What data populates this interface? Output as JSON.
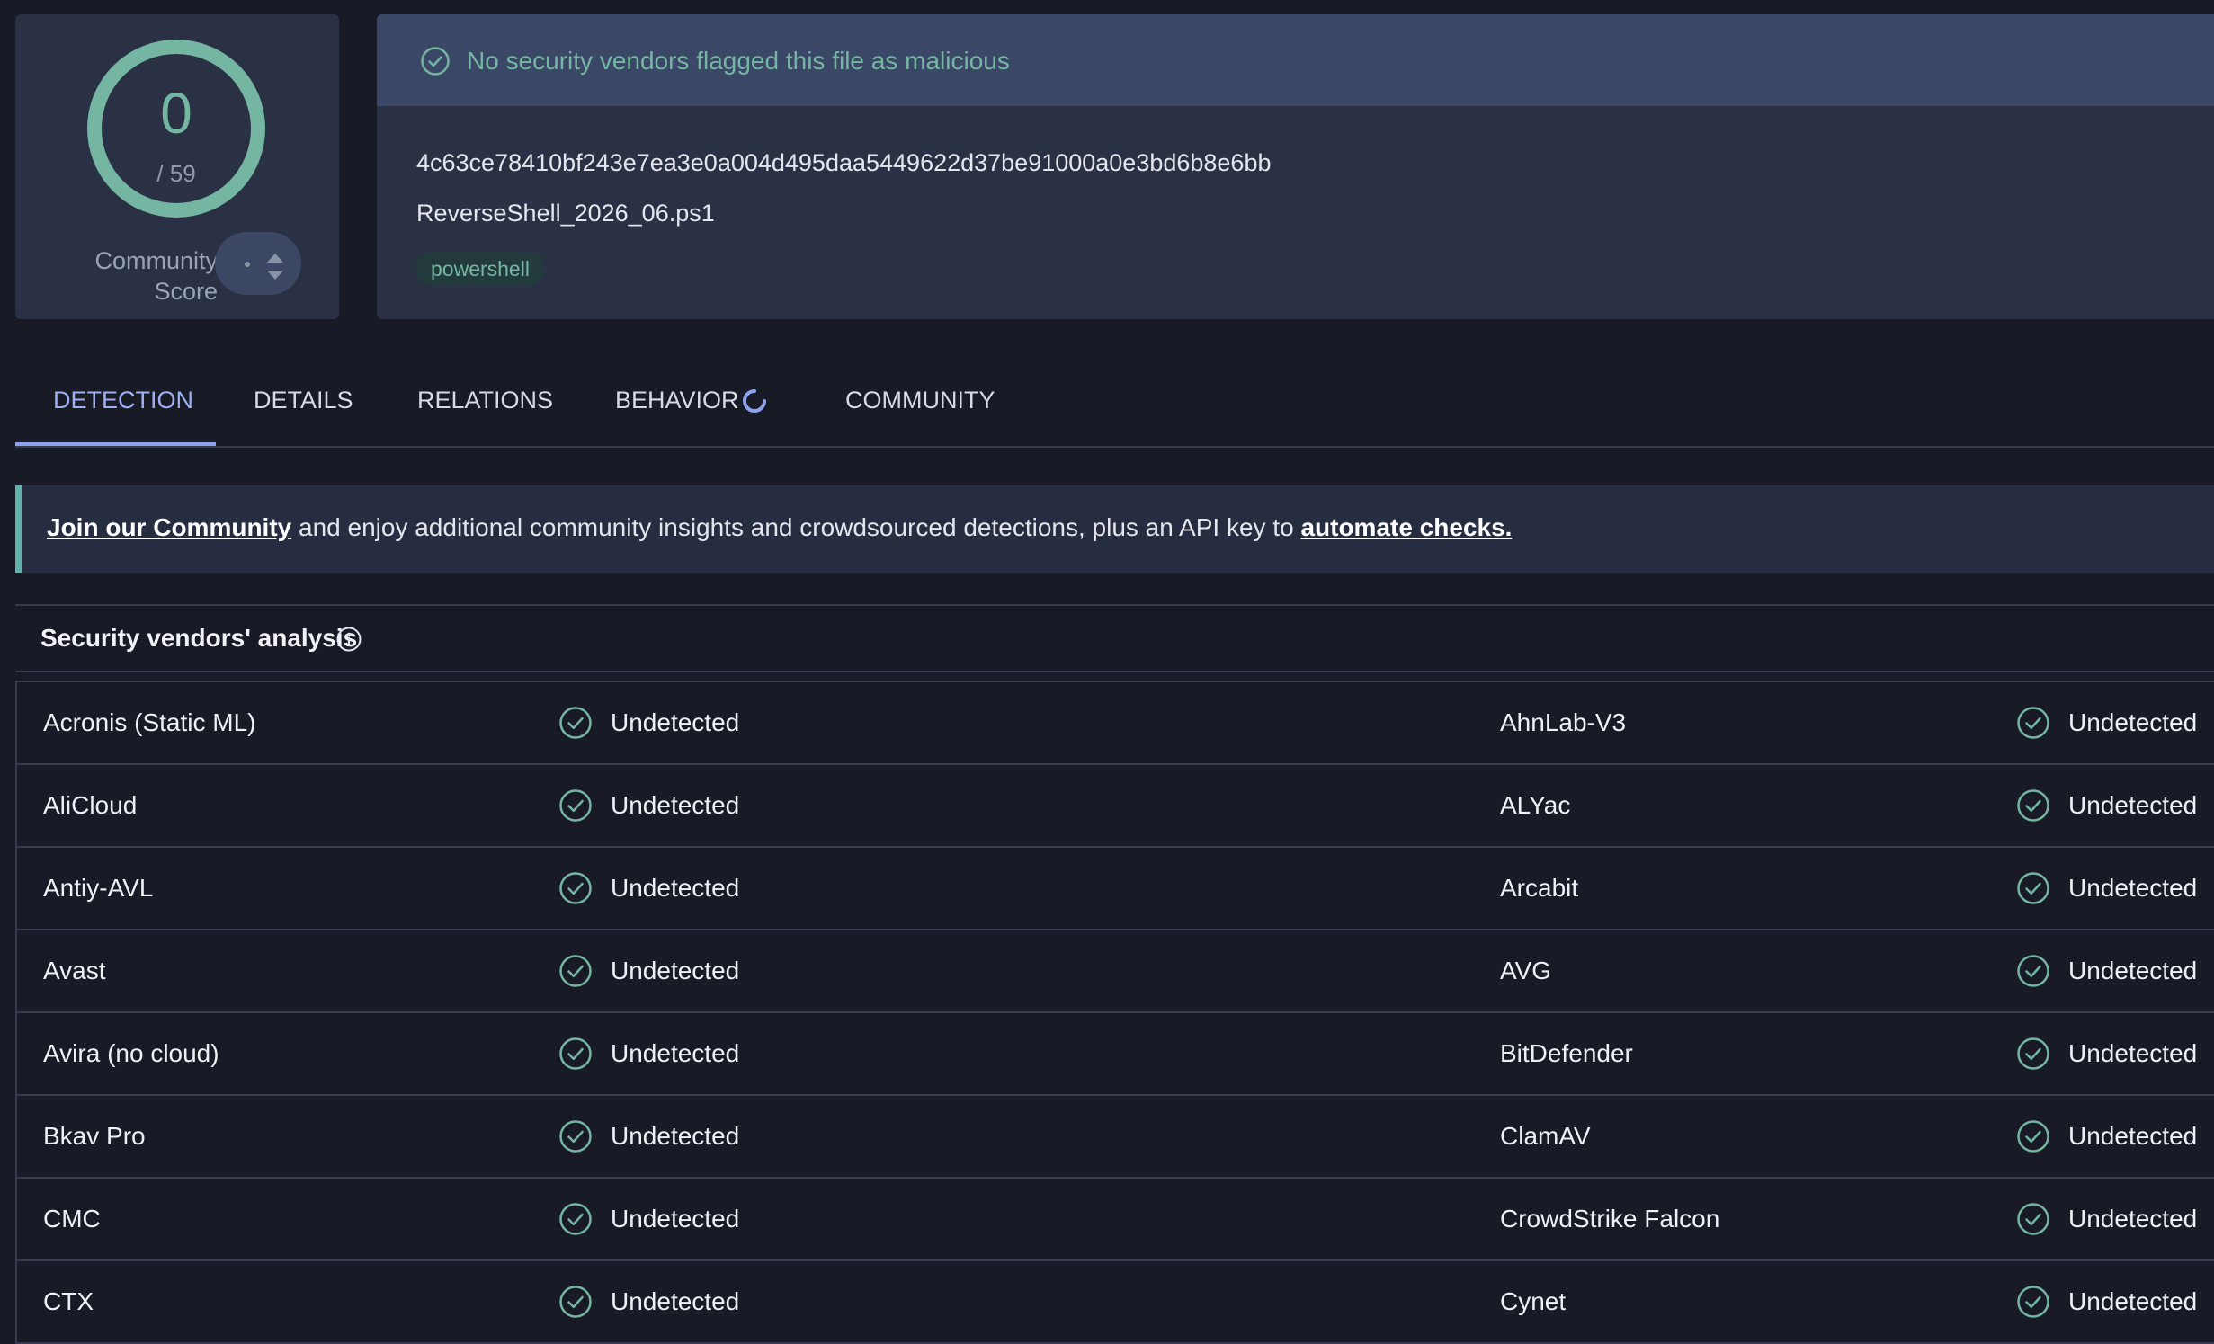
{
  "score": {
    "detections": "0",
    "total": "/ 59",
    "community_label": "Community Score",
    "community_value": "·"
  },
  "summary": {
    "banner": "No security vendors flagged this file as malicious",
    "hash": "4c63ce78410bf243e7ea3e0a004d495daa5449622d37be91000a0e3bd6b8e6bb",
    "filename": "ReverseShell_2026_06.ps1",
    "tag": "powershell"
  },
  "tabs": [
    {
      "label": "DETECTION",
      "active": true
    },
    {
      "label": "DETAILS",
      "active": false
    },
    {
      "label": "RELATIONS",
      "active": false
    },
    {
      "label": "BEHAVIOR",
      "active": false,
      "loading": true
    },
    {
      "label": "COMMUNITY",
      "active": false
    }
  ],
  "notice": {
    "link1": "Join our Community",
    "middle": " and enjoy additional community insights and crowdsourced detections, plus an API key to ",
    "link2": "automate checks."
  },
  "analysis": {
    "title": "Security vendors' analysis",
    "rows": [
      {
        "left": {
          "vendor": "Acronis (Static ML)",
          "result": "Undetected"
        },
        "right": {
          "vendor": "AhnLab-V3",
          "result": "Undetected"
        }
      },
      {
        "left": {
          "vendor": "AliCloud",
          "result": "Undetected"
        },
        "right": {
          "vendor": "ALYac",
          "result": "Undetected"
        }
      },
      {
        "left": {
          "vendor": "Antiy-AVL",
          "result": "Undetected"
        },
        "right": {
          "vendor": "Arcabit",
          "result": "Undetected"
        }
      },
      {
        "left": {
          "vendor": "Avast",
          "result": "Undetected"
        },
        "right": {
          "vendor": "AVG",
          "result": "Undetected"
        }
      },
      {
        "left": {
          "vendor": "Avira (no cloud)",
          "result": "Undetected"
        },
        "right": {
          "vendor": "BitDefender",
          "result": "Undetected"
        }
      },
      {
        "left": {
          "vendor": "Bkav Pro",
          "result": "Undetected"
        },
        "right": {
          "vendor": "ClamAV",
          "result": "Undetected"
        }
      },
      {
        "left": {
          "vendor": "CMC",
          "result": "Undetected"
        },
        "right": {
          "vendor": "CrowdStrike Falcon",
          "result": "Undetected"
        }
      },
      {
        "left": {
          "vendor": "CTX",
          "result": "Undetected"
        },
        "right": {
          "vendor": "Cynet",
          "result": "Undetected"
        }
      }
    ]
  },
  "colors": {
    "background": "#181a26",
    "card": "#2b3145",
    "banner": "#3a4766",
    "success": "#74b6a1",
    "tab_active": "#9fb0f2",
    "notice_accent": "#5fb3aa"
  }
}
